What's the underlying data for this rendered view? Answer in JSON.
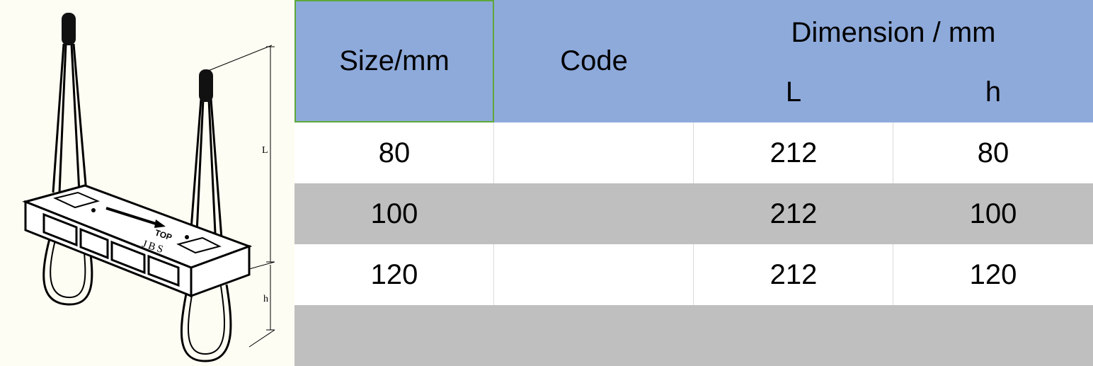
{
  "figure": {
    "plate_text_top": "TOP",
    "plate_text_brand": "JBS",
    "dim_label_L": "L",
    "dim_label_h": "h"
  },
  "table": {
    "headers": {
      "size": "Size/mm",
      "code": "Code",
      "dimension": "Dimension / mm",
      "L": "L",
      "h": "h"
    },
    "rows": [
      {
        "size": "80",
        "code": "",
        "L": "212",
        "h": "80"
      },
      {
        "size": "100",
        "code": "",
        "L": "212",
        "h": "100"
      },
      {
        "size": "120",
        "code": "",
        "L": "212",
        "h": "120"
      },
      {
        "size": "",
        "code": "",
        "L": "",
        "h": ""
      }
    ]
  },
  "colors": {
    "header_bg": "#8eaadb",
    "stripe_gray": "#bfbfbf",
    "drawing_bg": "#fefdf3"
  }
}
